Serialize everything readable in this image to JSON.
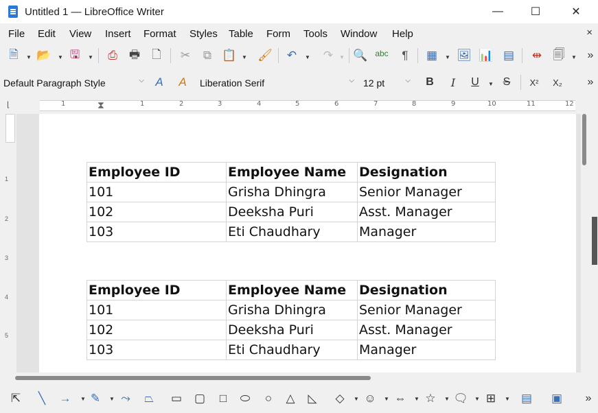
{
  "window": {
    "title": "Untitled 1 — LibreOffice Writer",
    "minimize": "—",
    "maximize": "☐",
    "close": "✕"
  },
  "menubar": {
    "items": [
      "File",
      "Edit",
      "View",
      "Insert",
      "Format",
      "Styles",
      "Table",
      "Form",
      "Tools",
      "Window",
      "Help"
    ],
    "close": "×"
  },
  "formatting": {
    "paragraph_style": "Default Paragraph Style",
    "font_name": "Liberation Serif",
    "font_size": "12 pt",
    "bold": "B",
    "italic": "I",
    "underline": "U",
    "strike": "S",
    "superscript": "X²",
    "subscript": "X₂",
    "more": "»"
  },
  "ruler": {
    "marks": [
      "1",
      "1",
      "2",
      "3",
      "4",
      "5",
      "6",
      "7",
      "8",
      "9",
      "10",
      "11",
      "12"
    ]
  },
  "vruler": {
    "marks": [
      "1",
      "2",
      "3",
      "4",
      "5"
    ]
  },
  "tables": [
    {
      "headers": [
        "Employee ID",
        "Employee Name",
        "Designation"
      ],
      "rows": [
        [
          "101",
          "Grisha Dhingra",
          "Senior Manager"
        ],
        [
          "102",
          "Deeksha Puri",
          "Asst. Manager"
        ],
        [
          "103",
          "Eti Chaudhary",
          "Manager"
        ]
      ]
    },
    {
      "headers": [
        "Employee ID",
        "Employee Name",
        "Designation"
      ],
      "rows": [
        [
          "101",
          "Grisha Dhingra",
          "Senior Manager"
        ],
        [
          "102",
          "Deeksha Puri",
          "Asst. Manager"
        ],
        [
          "103",
          "Eti Chaudhary",
          "Manager"
        ]
      ]
    }
  ],
  "toolbar_more": "»",
  "colors": {
    "accent": "#3a6fb5",
    "page": "#ffffff",
    "chrome": "#f0f0f0"
  }
}
